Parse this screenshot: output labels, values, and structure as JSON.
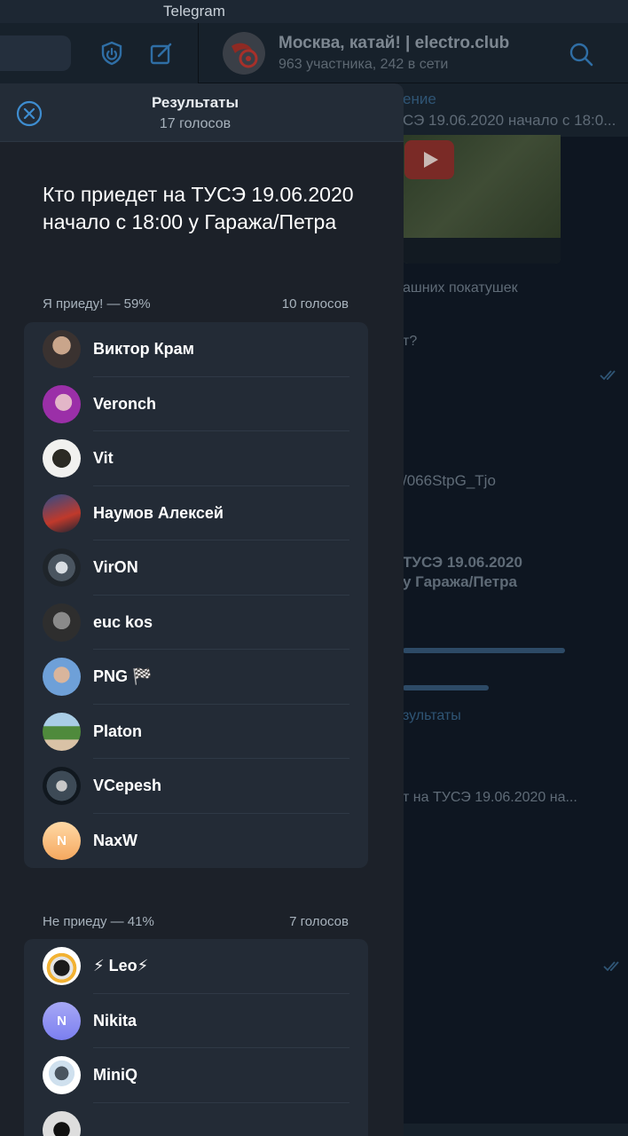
{
  "window": {
    "title": "Telegram"
  },
  "chat": {
    "title": "Москва, катай! | electro.club",
    "subtitle": "963 участника, 242 в сети",
    "pinned_label": "ение",
    "pinned_text": "СЭ 19.06.2020 начало с 18:0...",
    "bg_texts": [
      "ашних покатушек",
      "т?",
      "/066StpG_Tjo",
      "ТУСЭ 19.06.2020",
      "у Гаража/Петра",
      "зультаты",
      "т на ТУСЭ 19.06.2020 на..."
    ]
  },
  "results": {
    "title": "Результаты",
    "subtitle": "17 голосов",
    "question": "Кто приедет на ТУСЭ 19.06.2020 начало с 18:00 у Гаража/Петра",
    "options": [
      {
        "label": "Я приеду! — 59%",
        "count": "10 голосов",
        "voters": [
          {
            "name": "Виктор Крам"
          },
          {
            "name": "Veronch"
          },
          {
            "name": "Vit"
          },
          {
            "name": "Наумов Алексей"
          },
          {
            "name": "VirON"
          },
          {
            "name": "euc kos"
          },
          {
            "name": "PNG 🏁"
          },
          {
            "name": "Platon"
          },
          {
            "name": "VCepesh"
          },
          {
            "name": "NaxW",
            "initial": "N"
          }
        ]
      },
      {
        "label": "Не приеду — 41%",
        "count": "7 голосов",
        "voters": [
          {
            "name": "⚡ Leo⚡"
          },
          {
            "name": "Nikita",
            "initial": "N"
          },
          {
            "name": "MiniQ"
          }
        ]
      }
    ]
  },
  "colors": {
    "accent": "#3e8dd0",
    "panel_bg": "#1c2129",
    "card_bg": "#232b36",
    "header_bg": "#17212b"
  }
}
